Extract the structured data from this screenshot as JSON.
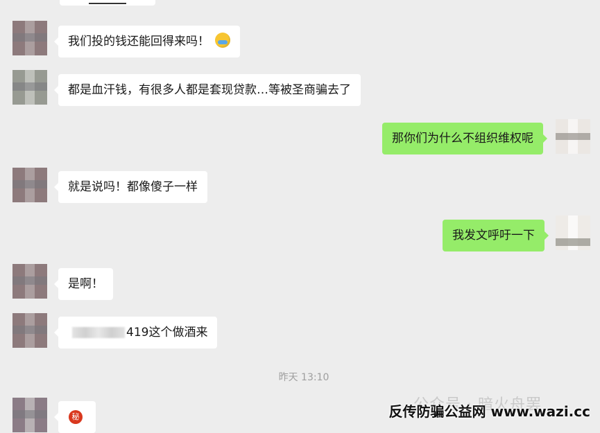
{
  "messages": [
    {
      "side": "left",
      "text": "我们投的钱还能回得来吗！",
      "emoji": "cry-laugh-emoji"
    },
    {
      "side": "left",
      "text": "都是血汗钱，有很多人都是套现贷款…等被圣商骗去了"
    },
    {
      "side": "right",
      "text": "那你们为什么不组织维权呢"
    },
    {
      "side": "left",
      "text": "就是说吗！都像傻子一样"
    },
    {
      "side": "right",
      "text": "我发文呼吁一下"
    },
    {
      "side": "left",
      "text": "是啊！"
    },
    {
      "side": "left",
      "text": "419这个做酒来",
      "redacted_prefix": true
    }
  ],
  "timestamp": "昨天 13:10",
  "last_message": {
    "icon": "secret-emoji-icon",
    "glyph": "秘"
  },
  "watermark": {
    "faded": "公众号 · 暗火舟罢",
    "text": "反传防骗公益网 www.wazi.cc"
  },
  "colors": {
    "background": "#ededed",
    "incoming_bubble": "#ffffff",
    "outgoing_bubble": "#95ec69"
  }
}
